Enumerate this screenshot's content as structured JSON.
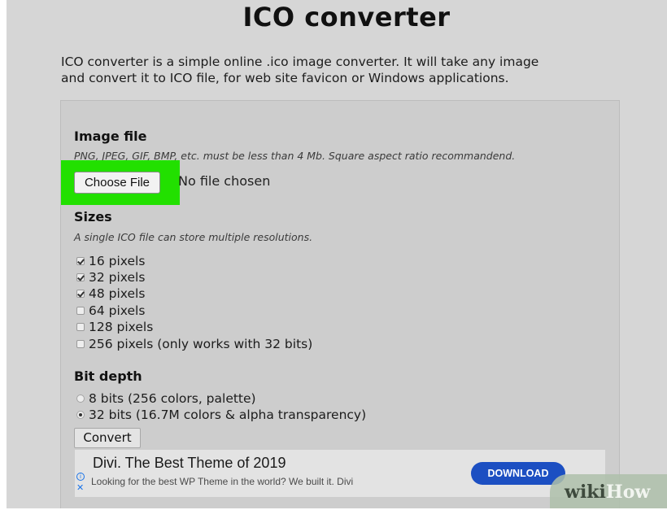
{
  "page": {
    "title": "ICO converter",
    "intro_line1": "ICO converter is a simple online .ico image converter. It will take any image",
    "intro_line2": "and convert it to ICO file, for web site favicon or Windows applications."
  },
  "image_file": {
    "heading": "Image file",
    "hint": "PNG, JPEG, GIF, BMP, etc. must be less than 4 Mb. Square aspect ratio recommandend.",
    "choose_button_label": "Choose File",
    "file_status": "No file chosen",
    "highlight_color": "#22e000"
  },
  "sizes": {
    "heading": "Sizes",
    "hint": "A single ICO file can store multiple resolutions.",
    "options": [
      {
        "label": "16 pixels",
        "checked": true
      },
      {
        "label": "32 pixels",
        "checked": true
      },
      {
        "label": "48 pixels",
        "checked": true
      },
      {
        "label": "64 pixels",
        "checked": false
      },
      {
        "label": "128 pixels",
        "checked": false
      },
      {
        "label": "256 pixels (only works with 32 bits)",
        "checked": false
      }
    ]
  },
  "bit_depth": {
    "heading": "Bit depth",
    "options": [
      {
        "label": "8 bits (256 colors, palette)",
        "selected": false
      },
      {
        "label": "32 bits (16.7M colors & alpha transparency)",
        "selected": true
      }
    ]
  },
  "convert_button_label": "Convert",
  "ad": {
    "title": "Divi. The Best Theme of 2019",
    "text": "Looking for the best WP Theme in the world? We built it. Divi",
    "button_label": "DOWNLOAD",
    "button_color": "#1c4fc2",
    "info_icon": "info-icon",
    "close_icon": "close-icon"
  },
  "watermark": {
    "part1": "wiki",
    "part2": "How"
  }
}
